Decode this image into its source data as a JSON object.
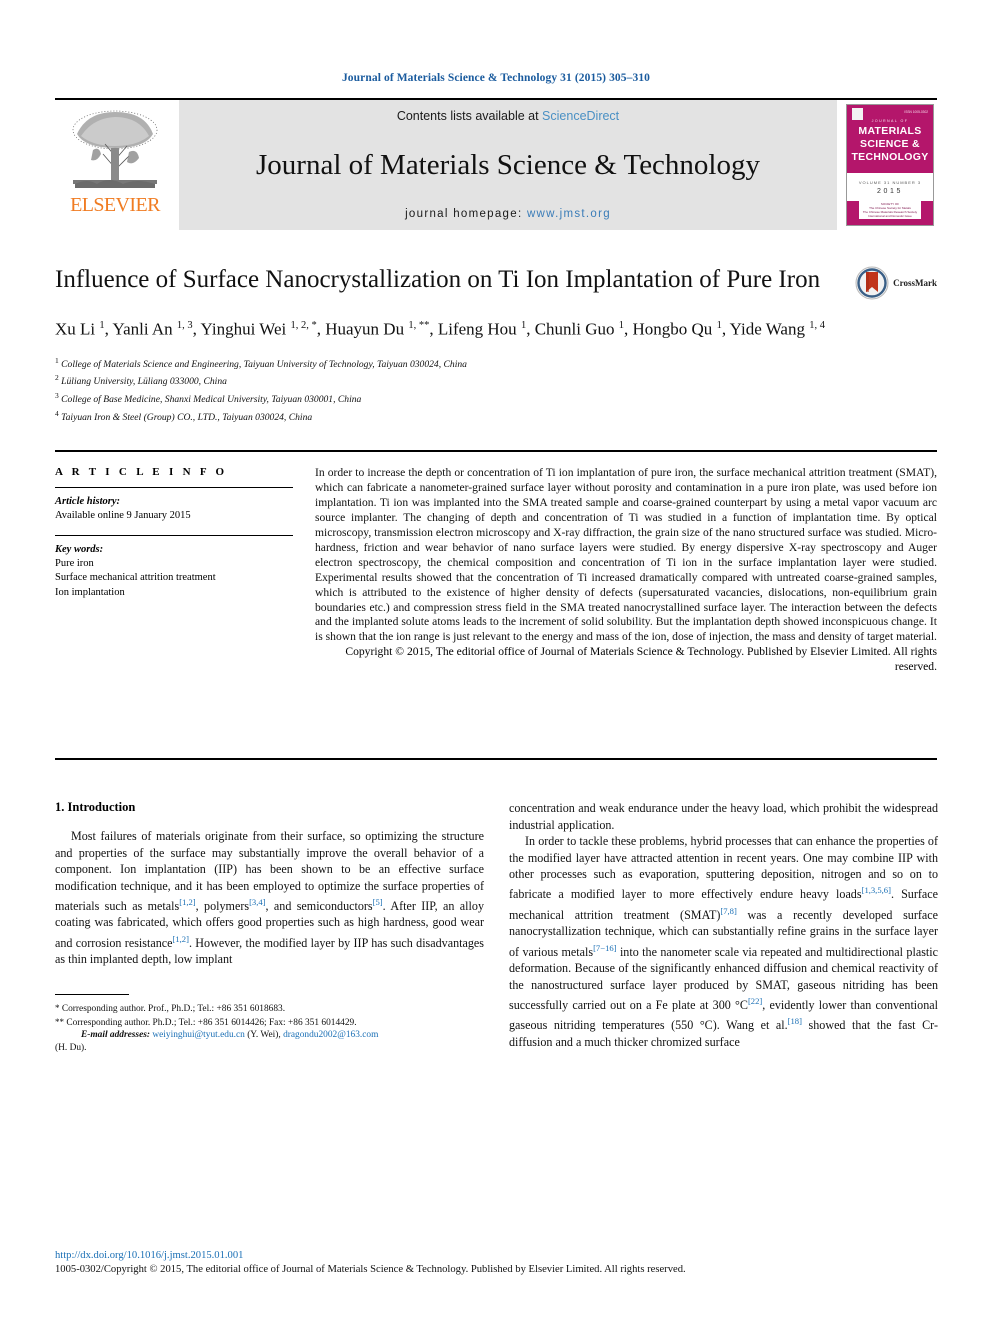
{
  "running_head": "Journal of Materials Science & Technology 31 (2015) 305–310",
  "masthead": {
    "publisher_name": "ELSEVIER",
    "contents_prefix": "Contents lists available at ",
    "contents_link": "ScienceDirect",
    "journal_name": "Journal of Materials Science & Technology",
    "homepage_prefix": "journal homepage: ",
    "homepage_url": "www.jmst.org",
    "cover": {
      "sub_label": "JOURNAL OF",
      "title_line1": "MATERIALS",
      "title_line2": "SCIENCE &",
      "title_line3": "TECHNOLOGY",
      "volume_line": "VOLUME 31  NUMBER 3",
      "year": "2015",
      "corner_text": "ISSN 1005-0302",
      "footer_text": "SOCIETY OF\nThe Chinese Society for Metals\nThe Chinese Materials Research Society\nInternational and Domestic Issue"
    }
  },
  "article": {
    "title": "Influence of Surface Nanocrystallization on Ti Ion Implantation of Pure Iron",
    "crossmark_label": "CrossMark",
    "authors_html": "Xu Li <sup>1</sup>, Yanli An <sup>1, 3</sup>, Yinghui Wei <sup>1, 2, *</sup>, Huayun Du <sup>1, **</sup>, Lifeng Hou <sup>1</sup>, Chunli Guo <sup>1</sup>, Hongbo Qu <sup>1</sup>, Yide Wang <sup>1, 4</sup>",
    "affiliations": [
      {
        "marker": "1",
        "text": "College of Materials Science and Engineering, Taiyuan University of Technology, Taiyuan 030024, China"
      },
      {
        "marker": "2",
        "text": "Lüliang University, Lüliang 033000, China"
      },
      {
        "marker": "3",
        "text": "College of Base Medicine, Shanxi Medical University, Taiyuan 030001, China"
      },
      {
        "marker": "4",
        "text": "Taiyuan Iron & Steel (Group) CO., LTD., Taiyuan 030024, China"
      }
    ]
  },
  "article_info": {
    "heading": "A R T I C L E   I N F O",
    "history_label": "Article history:",
    "history_value": "Available online 9 January 2015",
    "keywords_label": "Key words:",
    "keywords": [
      "Pure iron",
      "Surface mechanical attrition treatment",
      "Ion implantation"
    ]
  },
  "abstract": {
    "text": "In order to increase the depth or concentration of Ti ion implantation of pure iron, the surface mechanical attrition treatment (SMAT), which can fabricate a nanometer-grained surface layer without porosity and contamination in a pure iron plate, was used before ion implantation. Ti ion was implanted into the SMA treated sample and coarse-grained counterpart by using a metal vapor vacuum arc source implanter. The changing of depth and concentration of Ti was studied in a function of implantation time. By optical microscopy, transmission electron microscopy and X-ray diffraction, the grain size of the nano structured surface was studied. Micro-hardness, friction and wear behavior of nano surface layers were studied. By energy dispersive X-ray spectroscopy and Auger electron spectroscopy, the chemical composition and concentration of Ti ion in the surface implantation layer were studied. Experimental results showed that the concentration of Ti increased dramatically compared with untreated coarse-grained samples, which is attributed to the existence of higher density of defects (supersaturated vacancies, dislocations, non-equilibrium grain boundaries etc.) and compression stress field in the SMA treated nanocrystallined surface layer. The interaction between the defects and the implanted solute atoms leads to the increment of solid solubility. But the implantation depth showed inconspicuous change. It is shown that the ion range is just relevant to the energy and mass of the ion, dose of injection, the mass and density of target material.",
    "copyright": "Copyright © 2015, The editorial office of Journal of Materials Science & Technology. Published by Elsevier Limited. All rights reserved."
  },
  "introduction": {
    "heading": "1.  Introduction",
    "left_paragraph_html": "Most failures of materials originate from their surface, so optimizing the structure and properties of the surface may substantially improve the overall behavior of a component. Ion implantation (IIP) has been shown to be an effective surface modification technique, and it has been employed to optimize the surface properties of materials such as metals<sup class=\"ref\">[1,2]</sup>, polymers<sup class=\"ref\">[3,4]</sup>, and semiconductors<sup class=\"ref\">[5]</sup>. After IIP, an alloy coating was fabricated, which offers good properties such as high hardness, good wear and corrosion resistance<sup class=\"ref\">[1,2]</sup>. However, the modified layer by IIP has such disadvantages as thin implanted depth, low implant",
    "right_paragraph_1_html": "concentration and weak endurance under the heavy load, which prohibit the widespread industrial application.",
    "right_paragraph_2_html": "In order to tackle these problems, hybrid processes that can enhance the properties of the modified layer have attracted attention in recent years. One may combine IIP with other processes such as evaporation, sputtering deposition, nitrogen and so on to fabricate a modified layer to more effectively endure heavy loads<sup class=\"ref\">[1,3,5,6]</sup>. Surface mechanical attrition treatment (SMAT)<sup class=\"ref\">[7,8]</sup> was a recently developed surface nanocrystallization technique, which can substantially refine grains in the surface layer of various metals<sup class=\"ref\">[7−16]</sup> into the nanometer scale via repeated and multidirectional plastic deformation. Because of the significantly enhanced diffusion and chemical reactivity of the nanostructured surface layer produced by SMAT, gaseous nitriding has been successfully carried out on a Fe plate at 300 °C<sup class=\"ref\">[22]</sup>, evidently lower than conventional gaseous nitriding temperatures (550 °C). Wang et al.<sup class=\"ref\">[18]</sup> showed that the fast Cr-diffusion and a much thicker chromized surface"
  },
  "footnotes": {
    "line1": "Corresponding author. Prof., Ph.D.; Tel.: +86 351 6018683.",
    "marker1": "*",
    "line2": "Corresponding author. Ph.D.; Tel.: +86 351 6014426; Fax: +86 351 6014429.",
    "marker2": "**",
    "email_label": "E-mail addresses:",
    "email1": "weiyinghui@tyut.edu.cn",
    "email1_person": "(Y. Wei),",
    "email2": "dragondu2002@163.com",
    "email2_person": "(H. Du)."
  },
  "footer": {
    "doi": "http://dx.doi.org/10.1016/j.jmst.2015.01.001",
    "issn_copyright": "1005-0302/Copyright © 2015, The editorial office of Journal of Materials Science & Technology. Published by Elsevier Limited. All rights reserved."
  },
  "colors": {
    "link": "#1a6fb5",
    "running_head": "#1a5b9e",
    "elsevier_orange": "#f07c22",
    "cover_magenta": "#b4166b",
    "band_gray": "#e3e3e3"
  }
}
